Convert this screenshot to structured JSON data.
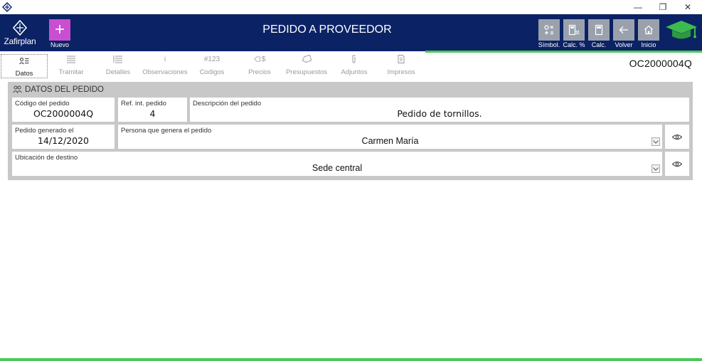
{
  "window": {
    "controls": {
      "minimize": "—",
      "restore": "❐",
      "close": "✕"
    }
  },
  "header": {
    "logo_text": "Zafirplan",
    "new_icon": "+",
    "new_label": "Nuevo",
    "title": "PEDIDO A PROVEEDOR",
    "tools": [
      {
        "label": "Símbol.",
        "icon": "symbols-icon"
      },
      {
        "label": "Calc. %",
        "icon": "percent-calculator-icon"
      },
      {
        "label": "Calc.",
        "icon": "calculator-icon"
      },
      {
        "label": "Volver",
        "icon": "arrow-left-icon"
      },
      {
        "label": "Inicio",
        "icon": "home-icon"
      }
    ],
    "accent_color": "#c94fd0",
    "bar_color": "#0b2265"
  },
  "tabs": [
    {
      "label": "Datos",
      "icon": "datos-icon",
      "active": true
    },
    {
      "label": "Tramitar",
      "icon": "list-icon",
      "active": false
    },
    {
      "label": "Detalles",
      "icon": "detail-list-icon",
      "active": false
    },
    {
      "label": "Observaciones",
      "icon": "info-icon",
      "glyph": "i",
      "active": false
    },
    {
      "label": "Codigos",
      "icon": "code-icon",
      "glyph": "#123",
      "active": false
    },
    {
      "label": "Precios",
      "icon": "price-tag-icon",
      "glyph": "$",
      "active": false
    },
    {
      "label": "Presupuestos",
      "icon": "tag-icon",
      "active": false
    },
    {
      "label": "Adjuntos",
      "icon": "paperclip-icon",
      "active": false
    },
    {
      "label": "Impresos",
      "icon": "document-icon",
      "active": false
    }
  ],
  "order_code": "OC2000004Q",
  "panel": {
    "title": "DATOS DEL PEDIDO",
    "fields": {
      "codigo": {
        "label": "Código del pedido",
        "value": "OC2000004Q"
      },
      "ref": {
        "label": "Ref. int. pedido",
        "value": "4"
      },
      "descripcion": {
        "label": "Descripción del pedido",
        "value": "Pedido de tornillos."
      },
      "fecha": {
        "label": "Pedido generado el",
        "value": "14/12/2020"
      },
      "persona": {
        "label": "Persona que genera el pedido",
        "value": "Carmen María"
      },
      "ubicacion": {
        "label": "Ubicación de destino",
        "value": "Sede central"
      }
    }
  },
  "status_color": "#4cc85a"
}
